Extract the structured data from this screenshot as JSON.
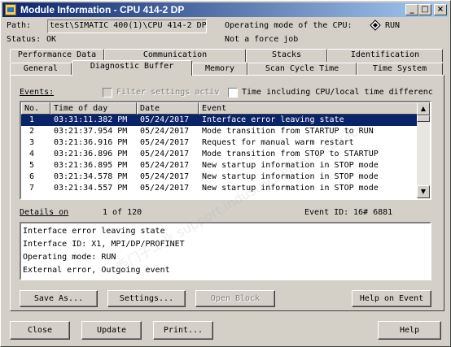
{
  "window": {
    "title": "Module Information - CPU 414-2 DP",
    "controls": [
      "_",
      "□",
      "×"
    ]
  },
  "path": {
    "label": "Path:",
    "value": "test\\SIMATIC 400(1)\\CPU 414-2 DP"
  },
  "status": {
    "label": "Status:",
    "value": "OK"
  },
  "operating_mode": {
    "label": "Operating mode of the  CPU:",
    "value": "RUN",
    "force": "Not a force job"
  },
  "tabs_top": [
    "Performance Data",
    "Communication",
    "Stacks",
    "Identification"
  ],
  "tabs_bottom": [
    "General",
    "Diagnostic Buffer",
    "Memory",
    "Scan Cycle Time",
    "Time System"
  ],
  "active_tab": "Diagnostic Buffer",
  "events": {
    "label": "Events:",
    "filter_label": "Filter settings activ",
    "time_label": "Time including CPU/local time differenc",
    "columns": [
      "No.",
      "Time of day",
      "Date",
      "Event"
    ],
    "rows": [
      {
        "no": "1",
        "time": "03:31:11.382 PM",
        "date": "05/24/2017",
        "event": "Interface error leaving state",
        "selected": true
      },
      {
        "no": "2",
        "time": "03:21:37.954 PM",
        "date": "05/24/2017",
        "event": "Mode transition from STARTUP to RUN",
        "selected": false
      },
      {
        "no": "3",
        "time": "03:21:36.916 PM",
        "date": "05/24/2017",
        "event": "Request for manual warm restart",
        "selected": false
      },
      {
        "no": "4",
        "time": "03:21:36.896 PM",
        "date": "05/24/2017",
        "event": "Mode transition from STOP to STARTUP",
        "selected": false
      },
      {
        "no": "5",
        "time": "03:21:36.895 PM",
        "date": "05/24/2017",
        "event": "New startup information in STOP mode",
        "selected": false
      },
      {
        "no": "6",
        "time": "03:21:34.578 PM",
        "date": "05/24/2017",
        "event": "New startup information in STOP mode",
        "selected": false
      },
      {
        "no": "7",
        "time": "03:21:34.557 PM",
        "date": "05/24/2017",
        "event": "New startup information in STOP mode",
        "selected": false
      }
    ]
  },
  "details": {
    "label": "Details on",
    "counter": "1 of 120",
    "event_id_label": "Event ID:",
    "event_id": "16# 6881",
    "lines": [
      "Interface error leaving state",
      "Interface ID: X1, MPI/DP/PROFINET",
      "Operating mode: RUN",
      "External error, Outgoing event"
    ]
  },
  "buttons": {
    "save_as": "Save As...",
    "settings": "Settings...",
    "open_block": "Open Block",
    "help_on_event": "Help on Event",
    "close": "Close",
    "update": "Update",
    "print": "Print...",
    "help": "Help"
  },
  "watermark": "西门子工业 support.industry.siemens.com/cs"
}
